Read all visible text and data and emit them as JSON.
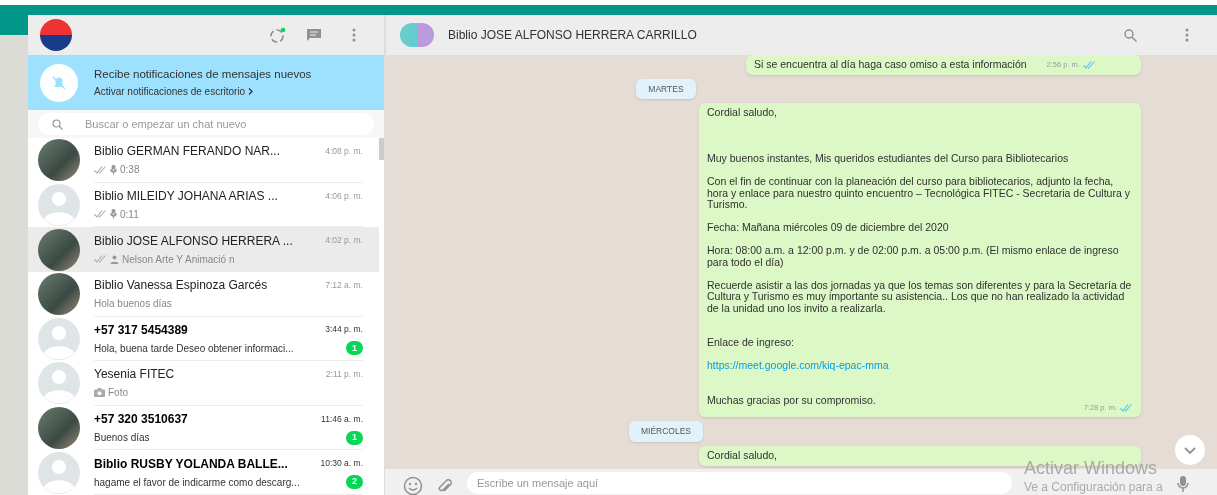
{
  "sidebar": {
    "notification": {
      "title": "Recibe notificaciones de mensajes nuevos",
      "link": "Activar notificaciones de escritorio"
    },
    "search": {
      "placeholder": "Buscar o empezar un chat nuevo"
    },
    "chats": [
      {
        "name": "Biblio GERMAN FERANDO NAR...",
        "time": "4:08 p. m.",
        "preview": "0:38",
        "attachment": {
          "kind": "mic"
        },
        "ticks": true,
        "photo": true,
        "selected": false
      },
      {
        "name": "Biblio MILEIDY JOHANA ARIAS ...",
        "time": "4:06 p. m.",
        "preview": "0:11",
        "attachment": {
          "kind": "mic"
        },
        "ticks": true,
        "photo": false,
        "selected": false
      },
      {
        "name": "Biblio JOSE ALFONSO HERRERA ...",
        "time": "4:02 p. m.",
        "preview": "Nelson Arte Y Animació n",
        "attachment": {
          "kind": "person"
        },
        "ticks": true,
        "photo": true,
        "selected": true
      },
      {
        "name": "Biblio Vanessa Espinoza Garcés",
        "time": "7:12 a. m.",
        "preview": "Hola buenos días",
        "ticks": false,
        "photo": true,
        "selected": false
      },
      {
        "name": "+57 317 5454389",
        "time": "3:44 p. m.",
        "preview": "Hola, buena tarde  Deseo obtener informaci...",
        "ticks": false,
        "photo": false,
        "unread": "1",
        "selected": false
      },
      {
        "name": "Yesenia FITEC",
        "time": "2:11 p. m.",
        "preview": "Foto",
        "attachment": {
          "kind": "camera"
        },
        "ticks": false,
        "photo": false,
        "selected": false
      },
      {
        "name": "+57 320 3510637",
        "time": "11:46 a. m.",
        "preview": "Buenos días",
        "ticks": false,
        "photo": true,
        "unread": "1",
        "selected": false
      },
      {
        "name": "Biblio RUSBY YOLANDA BALLE...",
        "time": "10:30 a. m.",
        "preview": "hagame el favor de indicarme como descarg...",
        "ticks": false,
        "photo": false,
        "unread": "2",
        "selected": false
      }
    ]
  },
  "conversation": {
    "title": "Biblio JOSE ALFONSO HERRERA CARRILLO",
    "items": [
      {
        "kind": "message",
        "parts": [
          {
            "kind": "text",
            "text": "Si se encuentra al día haga caso omiso a esta información"
          }
        ],
        "time": "2:56 p. m.",
        "read": true
      },
      {
        "kind": "date",
        "text": "MARTES"
      },
      {
        "kind": "message",
        "parts": [
          {
            "kind": "text",
            "text": "Cordial saludo,"
          },
          {
            "kind": "text",
            "text": "Muy buenos instantes, Mis queridos estudiantes del Curso para Bibliotecarios"
          },
          {
            "kind": "text",
            "text": "Con el fin de continuar con la planeación del curso para bibliotecarios, adjunto la fecha, hora y enlace para nuestro quinto encuentro – Tecnológica FITEC - Secretaria de Cultura y Turismo."
          },
          {
            "kind": "text",
            "text": "Fecha: Mañana miércoles 09 de diciembre del 2020"
          },
          {
            "kind": "text",
            "text": "Hora:  08:00 a.m. a 12:00 p.m. y de 02:00 p.m. a 05:00 p.m. (El mismo enlace de ingreso para todo el día)"
          },
          {
            "kind": "text",
            "text": "Recuerde asistir a las dos jornadas ya que los temas son diferentes y para la Secretaría de Cultura y Turismo es muy importante su asistencia.. Los que no han realizado la actividad de la unidad uno los invito a realizarla."
          },
          {
            "kind": "text",
            "text": "Enlace de ingreso:"
          },
          {
            "kind": "link",
            "text": "https://meet.google.com/kiq-epac-mma"
          },
          {
            "kind": "text",
            "text": "Muchas gracias por su compromiso."
          }
        ],
        "time": "7:28 p. m.",
        "read": true
      },
      {
        "kind": "date",
        "text": "MIÉRCOLES"
      },
      {
        "kind": "message",
        "parts": [
          {
            "kind": "text",
            "text": "Cordial saludo,"
          }
        ]
      }
    ],
    "composer": {
      "placeholder": "Escribe un mensaje aquí"
    }
  },
  "overlay": {
    "title": "Activar Windows",
    "subtitle": "Ve a Configuración para a"
  }
}
